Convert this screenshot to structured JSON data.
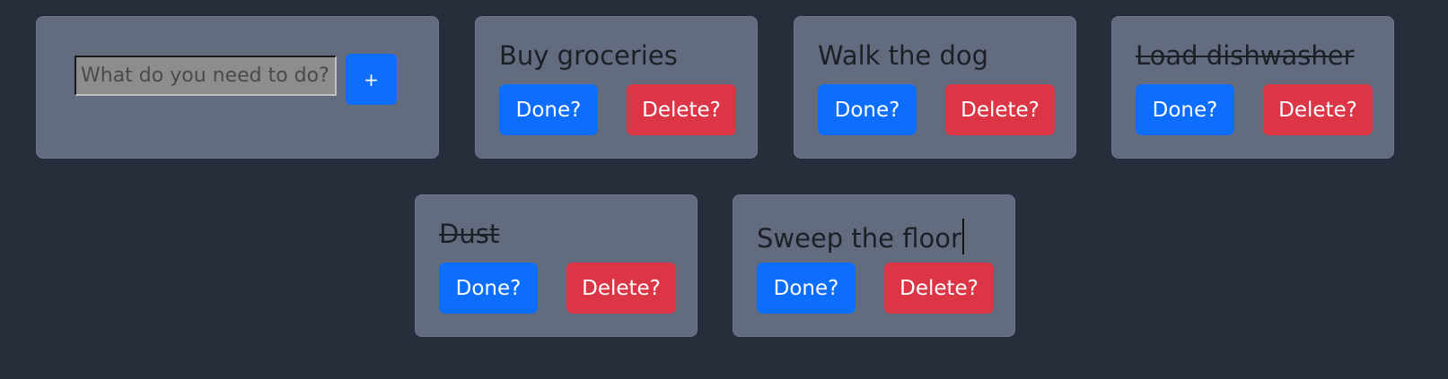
{
  "add_form": {
    "placeholder": "What do you need to do?",
    "add_label": "+"
  },
  "todos": [
    {
      "title": "Buy groceries",
      "completed": false,
      "done_label": "Done?",
      "delete_label": "Delete?"
    },
    {
      "title": "Walk the dog",
      "completed": false,
      "done_label": "Done?",
      "delete_label": "Delete?"
    },
    {
      "title": "Load dishwasher",
      "completed": true,
      "done_label": "Done?",
      "delete_label": "Delete?"
    },
    {
      "title": "Dust",
      "completed": true,
      "done_label": "Done?",
      "delete_label": "Delete?"
    },
    {
      "title": "Sweep the floor",
      "completed": false,
      "done_label": "Done?",
      "delete_label": "Delete?"
    }
  ],
  "colors": {
    "background": "#272d3b",
    "card": "#636b7f",
    "primary": "#0d6efd",
    "danger": "#dc3545"
  }
}
